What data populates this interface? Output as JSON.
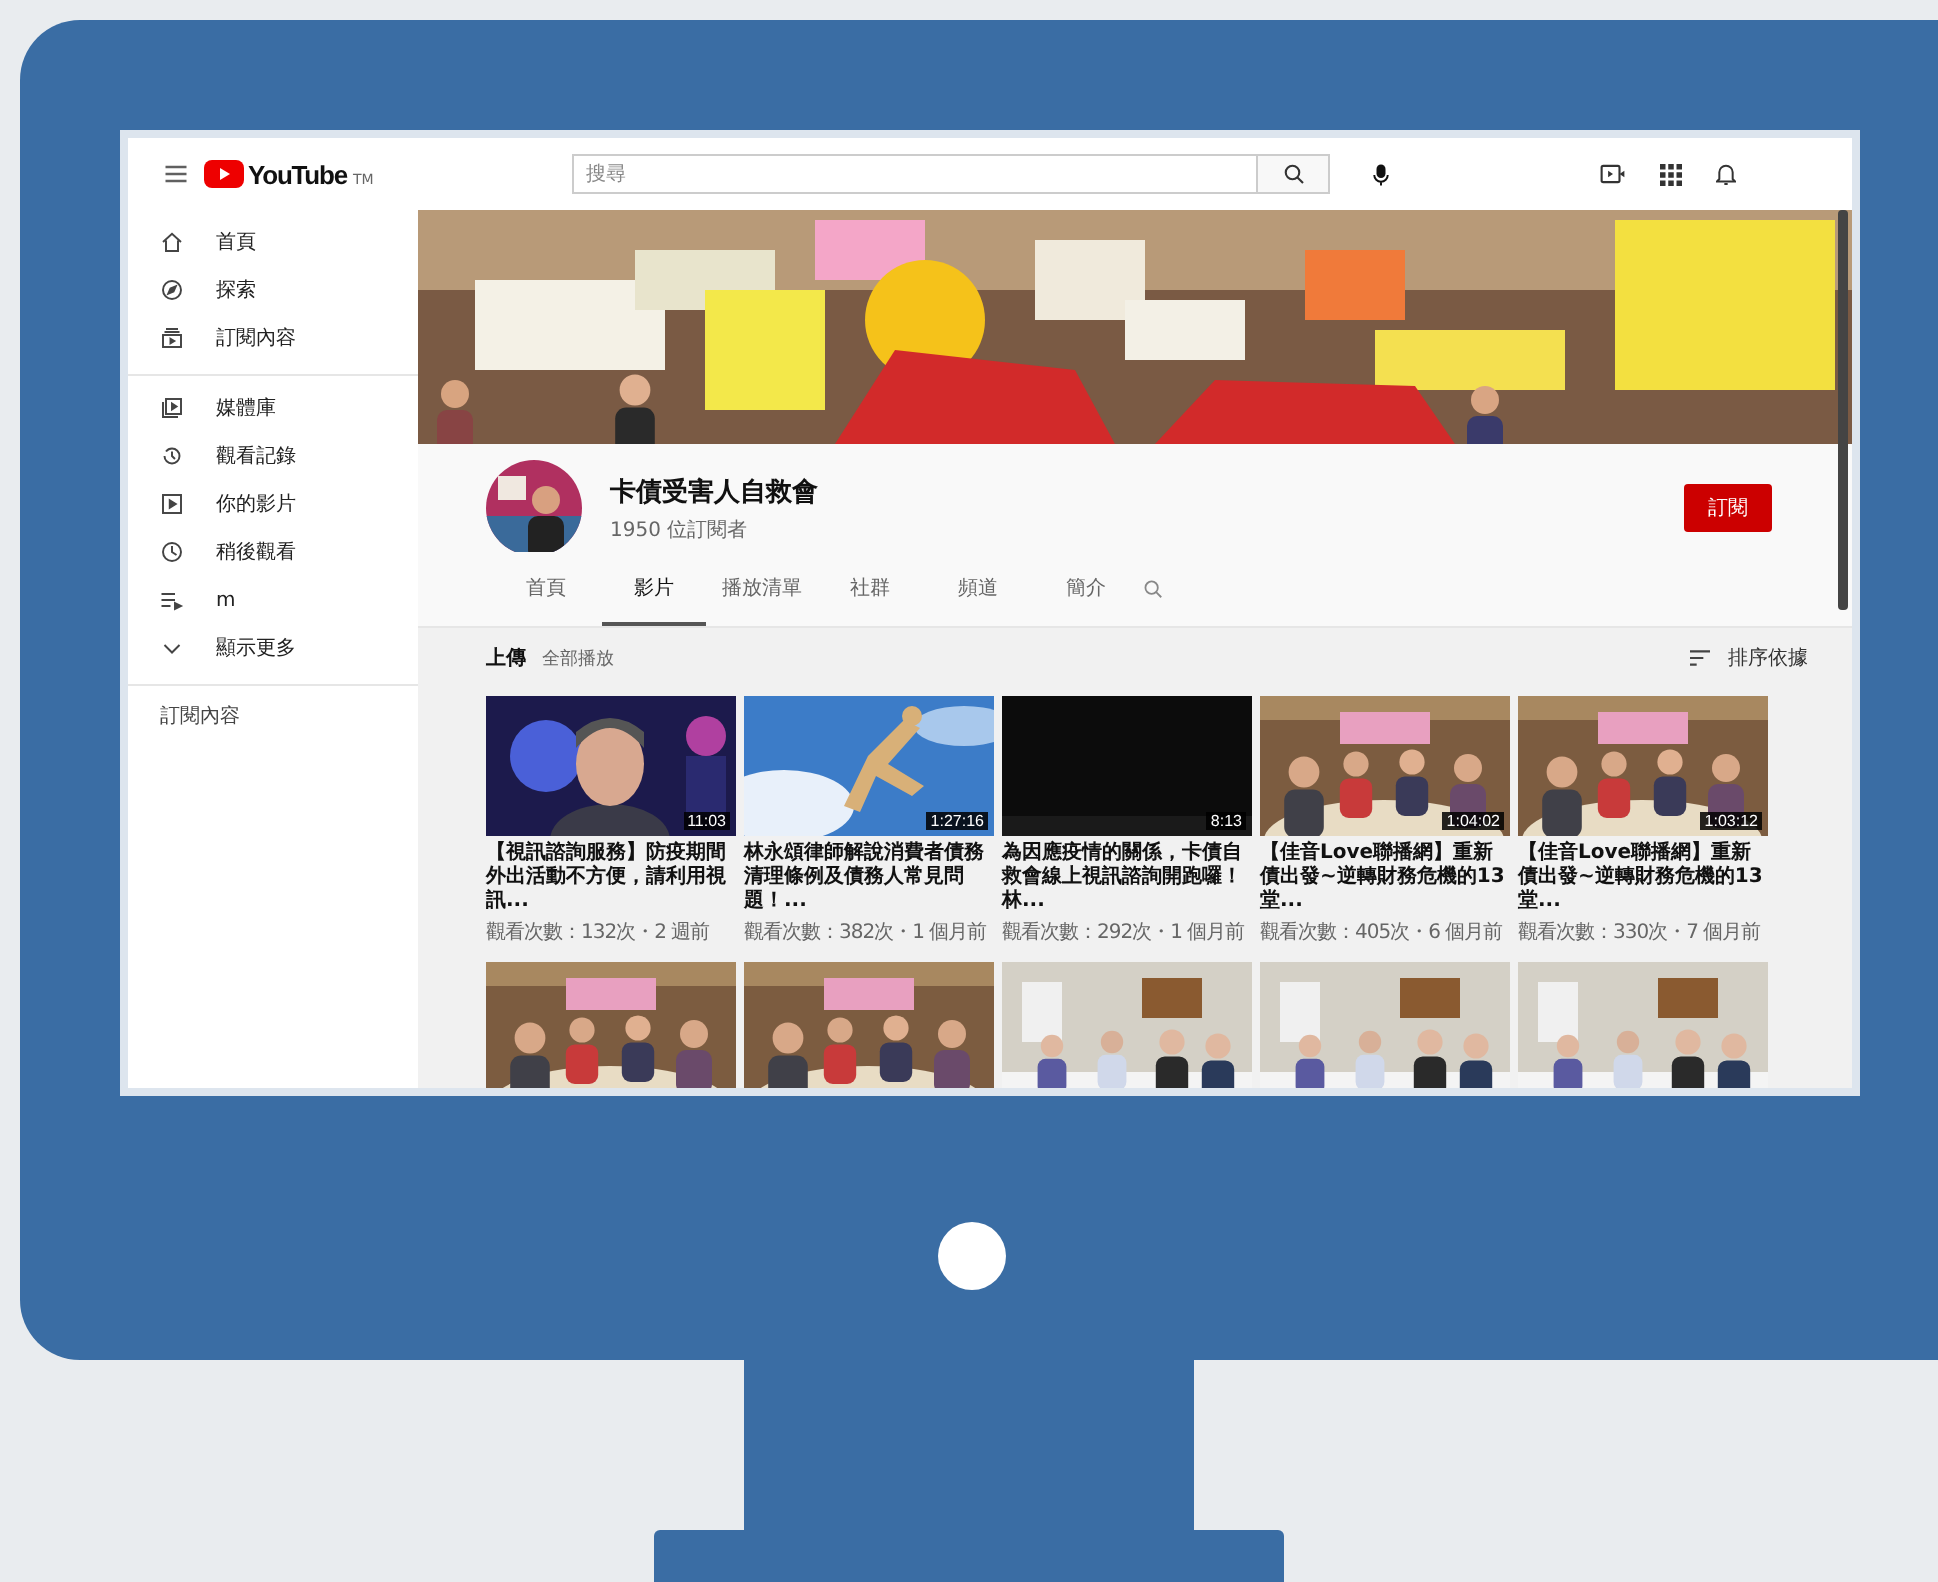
{
  "topbar": {
    "logo": "YouTube",
    "logo_mark": "TM",
    "search": {
      "placeholder": "搜尋"
    }
  },
  "sidebar": {
    "sections": [
      {
        "items": [
          {
            "label": "首頁"
          },
          {
            "label": "探索"
          },
          {
            "label": "訂閱內容"
          }
        ]
      },
      {
        "items": [
          {
            "label": "媒體庫"
          },
          {
            "label": "觀看記錄"
          },
          {
            "label": "你的影片"
          },
          {
            "label": "稍後觀看"
          },
          {
            "label": "m"
          },
          {
            "label": "顯示更多"
          }
        ]
      }
    ],
    "subscriptions_title": "訂閱內容"
  },
  "channel": {
    "name": "卡債受害人自救會",
    "subscribers": "1950 位訂閱者",
    "subscribe_button": "訂閱"
  },
  "tabs": [
    {
      "label": "首頁",
      "selected": false
    },
    {
      "label": "影片",
      "selected": true
    },
    {
      "label": "播放清單",
      "selected": false
    },
    {
      "label": "社群",
      "selected": false
    },
    {
      "label": "頻道",
      "selected": false
    },
    {
      "label": "簡介",
      "selected": false
    }
  ],
  "section": {
    "title": "上傳",
    "play_all": "全部播放",
    "sort": "排序依據"
  },
  "videos": [
    {
      "title": "【視訊諮詢服務】防疫期間外出活動不方便，請利用視訊...",
      "views": "觀看次數：132次・2 週前",
      "duration": "11:03"
    },
    {
      "title": "林永頌律師解說消費者債務清理條例及債務人常見問題！...",
      "views": "觀看次數：382次・1 個月前",
      "duration": "1:27:16"
    },
    {
      "title": "為因應疫情的關係，卡債自救會線上視訊諮詢開跑囉！林...",
      "views": "觀看次數：292次・1 個月前",
      "duration": "8:13"
    },
    {
      "title": "【佳音Love聯播網】重新債出發~逆轉財務危機的13堂...",
      "views": "觀看次數：405次・6 個月前",
      "duration": "1:04:02"
    },
    {
      "title": "【佳音Love聯播網】重新債出發~逆轉財務危機的13堂...",
      "views": "觀看次數：330次・7 個月前",
      "duration": "1:03:12"
    }
  ]
}
